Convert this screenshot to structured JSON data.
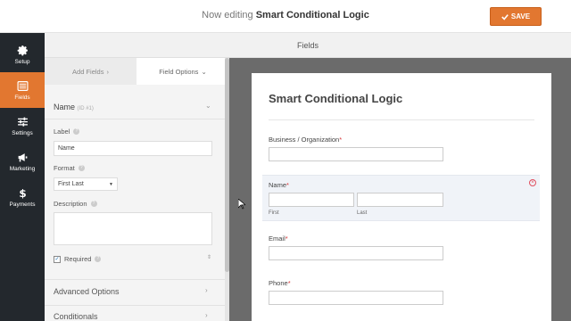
{
  "header": {
    "prefix": "Now editing",
    "form_name": "Smart Conditional Logic",
    "save_label": "SAVE"
  },
  "sidebar": {
    "items": [
      {
        "label": "Setup",
        "icon": "gear-icon"
      },
      {
        "label": "Fields",
        "icon": "list-icon",
        "active": true
      },
      {
        "label": "Settings",
        "icon": "sliders-icon"
      },
      {
        "label": "Marketing",
        "icon": "megaphone-icon"
      },
      {
        "label": "Payments",
        "icon": "dollar-icon"
      }
    ]
  },
  "fields_header": "Fields",
  "tabs": {
    "add_fields": "Add Fields",
    "field_options": "Field Options"
  },
  "options": {
    "section_title": "Name",
    "section_id": "(ID #1)",
    "label_label": "Label",
    "label_value": "Name",
    "format_label": "Format",
    "format_value": "First Last",
    "description_label": "Description",
    "required_label": "Required",
    "advanced_label": "Advanced Options",
    "conditionals_label": "Conditionals"
  },
  "preview": {
    "title": "Smart Conditional Logic",
    "fields": [
      {
        "label": "Business / Organization",
        "required": "*"
      },
      {
        "label": "Name",
        "required": "*",
        "sub_first": "First",
        "sub_last": "Last"
      },
      {
        "label": "Email",
        "required": "*"
      },
      {
        "label": "Phone",
        "required": "*"
      }
    ]
  },
  "colors": {
    "accent": "#e27730",
    "sidebar_bg": "#23282d",
    "preview_bg": "#6b6b6b"
  }
}
